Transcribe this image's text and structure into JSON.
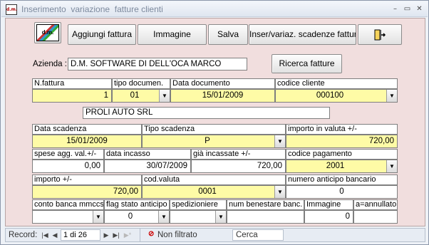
{
  "window": {
    "title": "Inserimento  variazione  fatture clienti",
    "app_icon_text": "d.m.",
    "minimize_glyph": "–",
    "restore_glyph": "▭",
    "close_glyph": "✕"
  },
  "toolbar": {
    "logo_text": "d.m.",
    "add_invoice": "Aggiungi fattura",
    "image": "Immagine",
    "save": "Salva",
    "schedule": "Inser/variaz. scadenze fattura",
    "exit_icon": "exit-door-icon"
  },
  "company": {
    "label": "Azienda :",
    "value": "D.M. SOFTWARE DI DELL'OCA MARCO",
    "search_button": "Ricerca fatture"
  },
  "invoice": {
    "number_label": "N.fattura",
    "number": "1",
    "doc_type_label": "tipo documen.",
    "doc_type": "01",
    "doc_date_label": "Data documento",
    "doc_date": "15/01/2009",
    "customer_code_label": "codice cliente",
    "customer_code": "000100",
    "customer_name": "PROLI AUTO SRL"
  },
  "schedule": {
    "due_date_label": "Data scadenza",
    "due_date": "15/01/2009",
    "due_type_label": "Tipo scadenza",
    "due_type": "P",
    "amount_curr_label": "importo in valuta +/-",
    "amount_curr": "720,00",
    "extra_costs_label": "spese agg. val.+/-",
    "extra_costs": "0,00",
    "collection_date_label": "data incasso",
    "collection_date": "30/07/2009",
    "already_collected_label": "già incassate +/-",
    "already_collected": "720,00",
    "payment_code_label": "codice pagamento",
    "payment_code": "2001",
    "amount_label": "importo +/-",
    "amount": "720,00",
    "currency_code_label": "cod.valuta",
    "currency_code": "0001",
    "bank_advance_label": "numero anticipo bancario",
    "bank_advance": "0",
    "bank_account_label": "conto banca mmccs",
    "bank_account": "",
    "advance_status_label": "flag stato anticipo",
    "advance_status": "0",
    "shipment_label": "spedizioniere",
    "shipment": "",
    "bank_approval_label": "num benestare banc.",
    "bank_approval": "",
    "image_label": "Immagine",
    "image_value": "0",
    "cancelled_label": "a=annullato",
    "cancelled": ""
  },
  "navigation": {
    "record_label": "Record:",
    "position": "1 di 26",
    "filter": "Non filtrato",
    "search": "Cerca",
    "first_glyph": "|◀",
    "prev_glyph": "◀",
    "next_glyph": "▶",
    "last_glyph": "▶|",
    "new_glyph": "▶*"
  },
  "colors": {
    "field": "#fefba6",
    "form_bg": "#f1dede"
  }
}
